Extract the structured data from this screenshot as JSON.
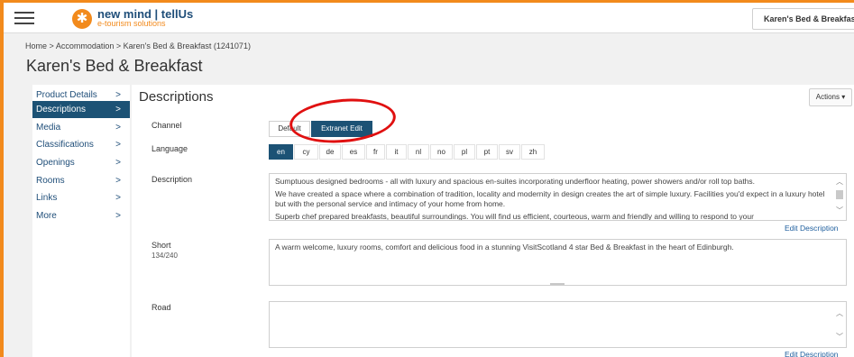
{
  "header": {
    "logo_title": "new mind | tellUs",
    "logo_subtitle": "e-tourism solutions",
    "account_name": "Karen's Bed & Breakfast"
  },
  "breadcrumb": {
    "home": "Home",
    "sep": ">",
    "accommodation": "Accommodation",
    "current": "Karen's Bed & Breakfast (1241071)"
  },
  "page_title": "Karen's Bed & Breakfast",
  "sidebar": {
    "chevron": ">",
    "items": [
      {
        "label": "Product Details"
      },
      {
        "label": "Descriptions"
      },
      {
        "label": "Media"
      },
      {
        "label": "Classifications"
      },
      {
        "label": "Openings"
      },
      {
        "label": "Rooms"
      },
      {
        "label": "Links"
      },
      {
        "label": "More"
      }
    ]
  },
  "main": {
    "title": "Descriptions",
    "actions_label": "Actions ▾",
    "channel": {
      "label": "Channel",
      "options": [
        "Default",
        "Extranet Edit"
      ],
      "selected": "Extranet Edit"
    },
    "language": {
      "label": "Language",
      "options": [
        "en",
        "cy",
        "de",
        "es",
        "fr",
        "it",
        "nl",
        "no",
        "pl",
        "pt",
        "sv",
        "zh"
      ],
      "selected": "en"
    },
    "description": {
      "label": "Description",
      "p1": "Sumptuous designed bedrooms - all with luxury and spacious en-suites incorporating underfloor heating, power showers and/or roll top baths.",
      "p2": "We have created a space where a combination of tradition, locality and modernity in design creates the art of simple luxury. Facilities you'd expect in a luxury hotel but with the personal service and intimacy of your home from home.",
      "p3": "Superb chef prepared breakfasts, beautiful surroundings. You will find us efficient, courteous, warm and friendly and willing to respond to your",
      "edit_link": "Edit Description"
    },
    "short": {
      "label": "Short",
      "count": "134/240",
      "text": "A warm welcome, luxury rooms, comfort and delicious food in a stunning VisitScotland 4 star Bed & Breakfast in the heart of Edinburgh."
    },
    "road": {
      "label": "Road",
      "text": "",
      "edit_link": "Edit Description"
    }
  },
  "colors": {
    "accent_orange": "#f28a1c",
    "active_blue": "#1c5275",
    "annotation_red": "#e01010"
  }
}
